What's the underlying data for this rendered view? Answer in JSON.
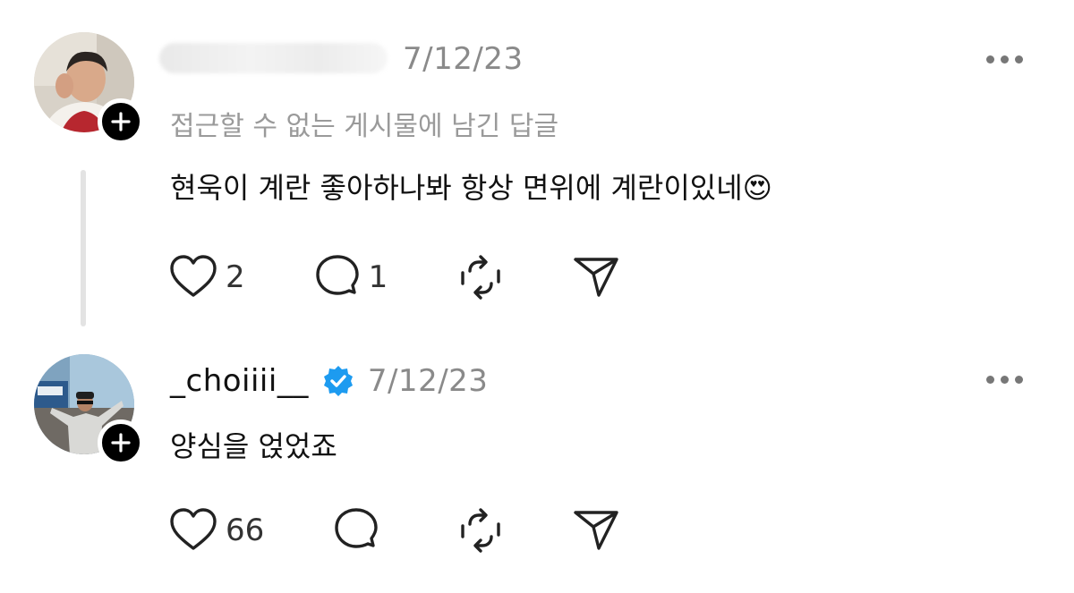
{
  "posts": [
    {
      "username": "",
      "timestamp": "7/12/23",
      "subline": "접근할 수 없는 게시물에 남긴 답글",
      "text": "현욱이 계란 좋아하나봐 항상 면위에 계란이있네",
      "emoji": "😍",
      "likes": "2",
      "replies": "1",
      "verified": false
    },
    {
      "username": "_choiiii__",
      "timestamp": "7/12/23",
      "text": "양심을 얹었죠",
      "likes": "66",
      "replies": "",
      "verified": true
    }
  ],
  "icons": {
    "like": "heart-icon",
    "reply": "comment-icon",
    "repost": "repost-icon",
    "share": "send-icon",
    "more": "more-icon",
    "follow": "plus-icon",
    "verified": "verified-badge-icon"
  },
  "colors": {
    "verified": "#1d9bf0",
    "muted": "#8a8a8a"
  }
}
